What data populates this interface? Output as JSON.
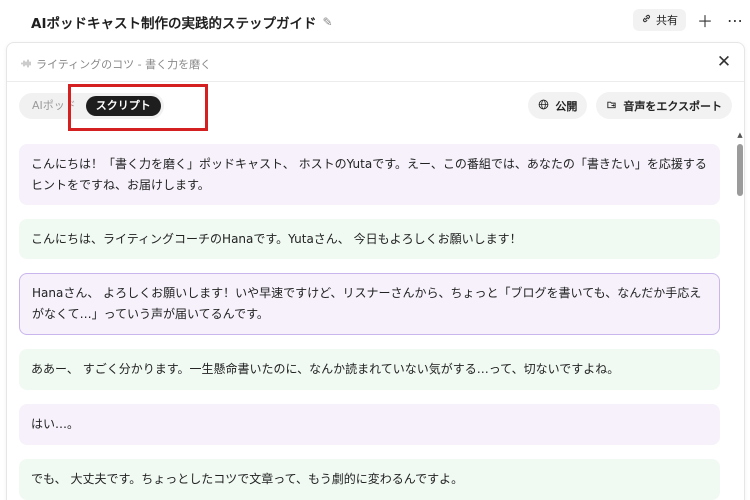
{
  "header": {
    "title": "AIポッドキャスト制作の実践的ステップガイド",
    "edit_icon": "pencil-icon",
    "share_label": "共有",
    "share_icon": "link-icon",
    "add_icon": "plus-icon",
    "more_icon": "ellipsis-icon"
  },
  "panel": {
    "subtitle": "ライティングのコツ - 書く力を磨く",
    "subtitle_icon": "waveform-icon",
    "close_icon": "close-icon",
    "tabs": [
      {
        "label": "AIポッド",
        "active": false
      },
      {
        "label": "スクリプト",
        "active": true
      }
    ],
    "publish_label": "公開",
    "publish_icon": "globe-icon",
    "export_label": "音声をエクスポート",
    "export_icon": "export-icon"
  },
  "messages": [
    {
      "speaker": "host",
      "text": "こんにちは！「書く力を磨く」ポッドキャスト、 ホストのYutaです。えー、この番組では、あなたの「書きたい」を応援するヒントをですね、お届けします。"
    },
    {
      "speaker": "guest",
      "text": "こんにちは、ライティングコーチのHanaです。Yutaさん、 今日もよろしくお願いします！"
    },
    {
      "speaker": "host",
      "text": "Hanaさん、 よろしくお願いします！いや早速ですけど、リスナーさんから、ちょっと「ブログを書いても、なんだか手応えがなくて…」っていう声が届いてるんです。"
    },
    {
      "speaker": "guest",
      "text": "ああー、 すごく分かります。一生懸命書いたのに、なんか読まれていない気がする…って、切ないですよね。"
    },
    {
      "speaker": "host",
      "text": "はい…。"
    },
    {
      "speaker": "guest",
      "text": "でも、 大丈夫です。ちょっとしたコツで文章って、もう劇的に変わるんですよ。"
    }
  ],
  "colors": {
    "host_bg": "#f6f1fb",
    "guest_bg": "#f0faf3",
    "selected_border": "#c9b6ec",
    "highlight": "#d42020",
    "active_tab": "#1e1e1e"
  }
}
